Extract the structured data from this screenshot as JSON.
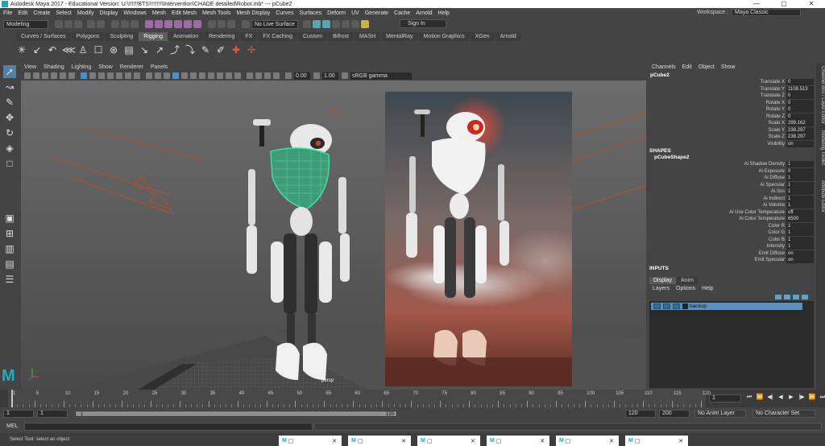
{
  "window": {
    "title": "Autodesk Maya 2017 - Educational Version: U:\\!!!!!!BTS!!!!!!!!\\Intervention\\CHADE detailed\\Robot.mb*  ---  pCube2",
    "minimize": "—",
    "maximize": "▢",
    "close": "✕"
  },
  "menubar": {
    "items": [
      "File",
      "Edit",
      "Create",
      "Select",
      "Modify",
      "Display",
      "Windows",
      "Mesh",
      "Edit Mesh",
      "Mesh Tools",
      "Mesh Display",
      "Curves",
      "Surfaces",
      "Deform",
      "UV",
      "Generate",
      "Cache",
      "Arnold",
      "Help"
    ],
    "workspace_label": "Workspace :",
    "workspace_value": "Maya Classic"
  },
  "statusline": {
    "mode": "Modeling",
    "live_surface": "No Live Surface",
    "sign_in": "Sign In"
  },
  "shelf": {
    "tabs": [
      "Curves / Surfaces",
      "Polygons",
      "Sculpting",
      "Rigging",
      "Animation",
      "Rendering",
      "FX",
      "FX Caching",
      "Custom",
      "Bifrost",
      "MASH",
      "MentalRay",
      "Motion Graphics",
      "XGen",
      "Arnold"
    ],
    "active_tab": "Rigging",
    "icons": [
      "joint-icon",
      "ik-handle-icon",
      "ik-spline-icon",
      "mirror-joint-icon",
      "humanik-icon",
      "bind-skin-icon",
      "smooth-skin-icon",
      "paint-weights-icon",
      "blend-shape-icon",
      "cluster-icon",
      "lattice-icon",
      "wrap-icon",
      "wire-icon",
      "nonlinear-icon",
      "locator-icon",
      "constraint-icon"
    ]
  },
  "viewport": {
    "menu": [
      "View",
      "Shading",
      "Lighting",
      "Show",
      "Renderer",
      "Panels"
    ],
    "exposure": "0.00",
    "gamma": "1.00",
    "color_space": "sRGB gamma",
    "camera_label": "persp"
  },
  "channelbox": {
    "menu": [
      "Channels",
      "Edit",
      "Object",
      "Show"
    ],
    "object_name": "pCube2",
    "transform": [
      {
        "name": "Translate X",
        "value": "0"
      },
      {
        "name": "Translate Y",
        "value": "1108.513"
      },
      {
        "name": "Translate Z",
        "value": "0"
      },
      {
        "name": "Rotate X",
        "value": "0"
      },
      {
        "name": "Rotate Y",
        "value": "0"
      },
      {
        "name": "Rotate Z",
        "value": "0"
      },
      {
        "name": "Scale X",
        "value": "299.162"
      },
      {
        "name": "Scale Y",
        "value": "238.297"
      },
      {
        "name": "Scale Z",
        "value": "238.297"
      },
      {
        "name": "Visibility",
        "value": "on"
      }
    ],
    "shapes_label": "SHAPES",
    "shape_name": "pCubeShape2",
    "shape_attrs": [
      {
        "name": "Ai Shadow Density",
        "value": "1"
      },
      {
        "name": "Ai Exposure",
        "value": "0"
      },
      {
        "name": "Ai Diffuse",
        "value": "1"
      },
      {
        "name": "Ai Specular",
        "value": "1"
      },
      {
        "name": "Ai Sss",
        "value": "1"
      },
      {
        "name": "Ai Indirect",
        "value": "1"
      },
      {
        "name": "Ai Volume",
        "value": "1"
      },
      {
        "name": "Ai Use Color Temperature",
        "value": "off"
      },
      {
        "name": "Ai Color Temperature",
        "value": "6500"
      },
      {
        "name": "Color R",
        "value": "1"
      },
      {
        "name": "Color G",
        "value": "1"
      },
      {
        "name": "Color B",
        "value": "1"
      },
      {
        "name": "Intensity",
        "value": "1"
      },
      {
        "name": "Emit Diffuse",
        "value": "on"
      },
      {
        "name": "Emit Specular",
        "value": "on"
      }
    ],
    "inputs_label": "INPUTS",
    "side_tabs": [
      "Channel Box / Layer Editor",
      "Modeling Toolkit",
      "Attribute Editor"
    ]
  },
  "layers": {
    "tabs": [
      "Display",
      "Anim"
    ],
    "menu": [
      "Layers",
      "Options",
      "Help"
    ],
    "items": [
      {
        "name": "backup"
      }
    ]
  },
  "timeslider": {
    "ticks": [
      "1",
      "5",
      "10",
      "15",
      "20",
      "25",
      "30",
      "35",
      "40",
      "45",
      "50",
      "55",
      "60",
      "65",
      "70",
      "75",
      "80",
      "85",
      "90",
      "95",
      "100",
      "105",
      "110",
      "115",
      "120"
    ],
    "current_frame": "1"
  },
  "range": {
    "start": "1",
    "playback_start": "1",
    "slider_start": "1",
    "slider_end": "120",
    "playback_end": "120",
    "end": "200",
    "anim_layer": "No Anim Layer",
    "character_set": "No Character Set"
  },
  "cmdline": {
    "label": "MEL"
  },
  "helpline": {
    "text": "Select Tool: select an object"
  },
  "taskbar": {
    "items": [
      "M",
      "M",
      "M",
      "M",
      "M",
      "M"
    ]
  },
  "colors": {
    "accent": "#5382a1",
    "maya_teal": "#1aa7b8",
    "wireframe_green": "#3de6a0"
  }
}
